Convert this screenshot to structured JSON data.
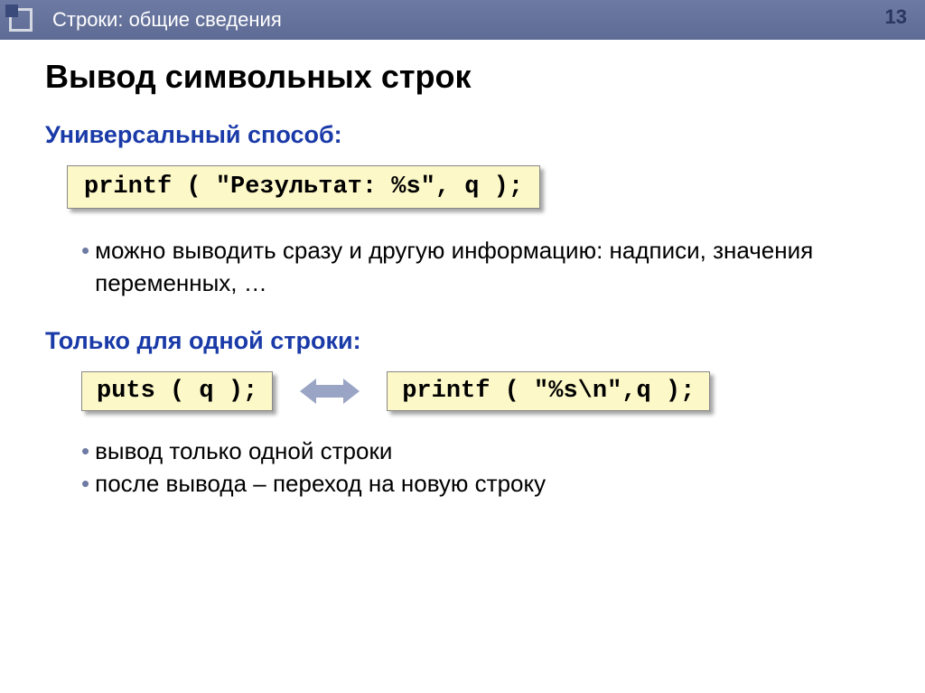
{
  "header": {
    "breadcrumb": "Строки: общие сведения",
    "page_number": "13"
  },
  "title": "Вывод символьных строк",
  "section1": {
    "title": "Универсальный способ:",
    "code": "printf ( \"Результат: %s\", q );",
    "bullets": [
      "можно выводить сразу и другую информацию: надписи, значения переменных, …"
    ]
  },
  "section2": {
    "title": "Только для одной строки:",
    "code_left": "puts ( q );",
    "code_right": "printf ( \"%s\\n\",q );",
    "bullets": [
      "вывод только одной строки",
      "после вывода – переход на новую строку"
    ]
  }
}
